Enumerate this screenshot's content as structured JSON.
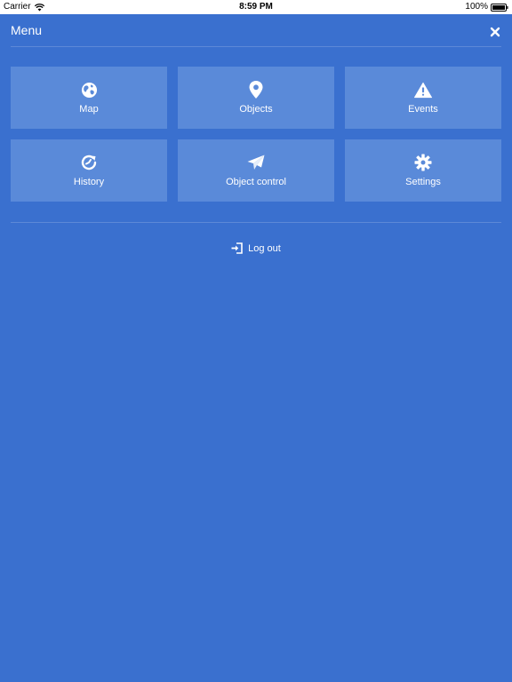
{
  "status_bar": {
    "carrier": "Carrier",
    "time": "8:59 PM",
    "battery": "100%"
  },
  "header": {
    "title": "Menu"
  },
  "tiles": [
    {
      "label": "Map",
      "icon": "globe-icon"
    },
    {
      "label": "Objects",
      "icon": "map-pin-icon"
    },
    {
      "label": "Events",
      "icon": "warning-icon"
    },
    {
      "label": "History",
      "icon": "history-icon"
    },
    {
      "label": "Object control",
      "icon": "paper-plane-icon"
    },
    {
      "label": "Settings",
      "icon": "gear-icon"
    }
  ],
  "logout": {
    "label": "Log out",
    "icon": "logout-icon"
  },
  "colors": {
    "background": "#3a70cf",
    "tile": "#5a8ad9",
    "text": "#ffffff"
  }
}
